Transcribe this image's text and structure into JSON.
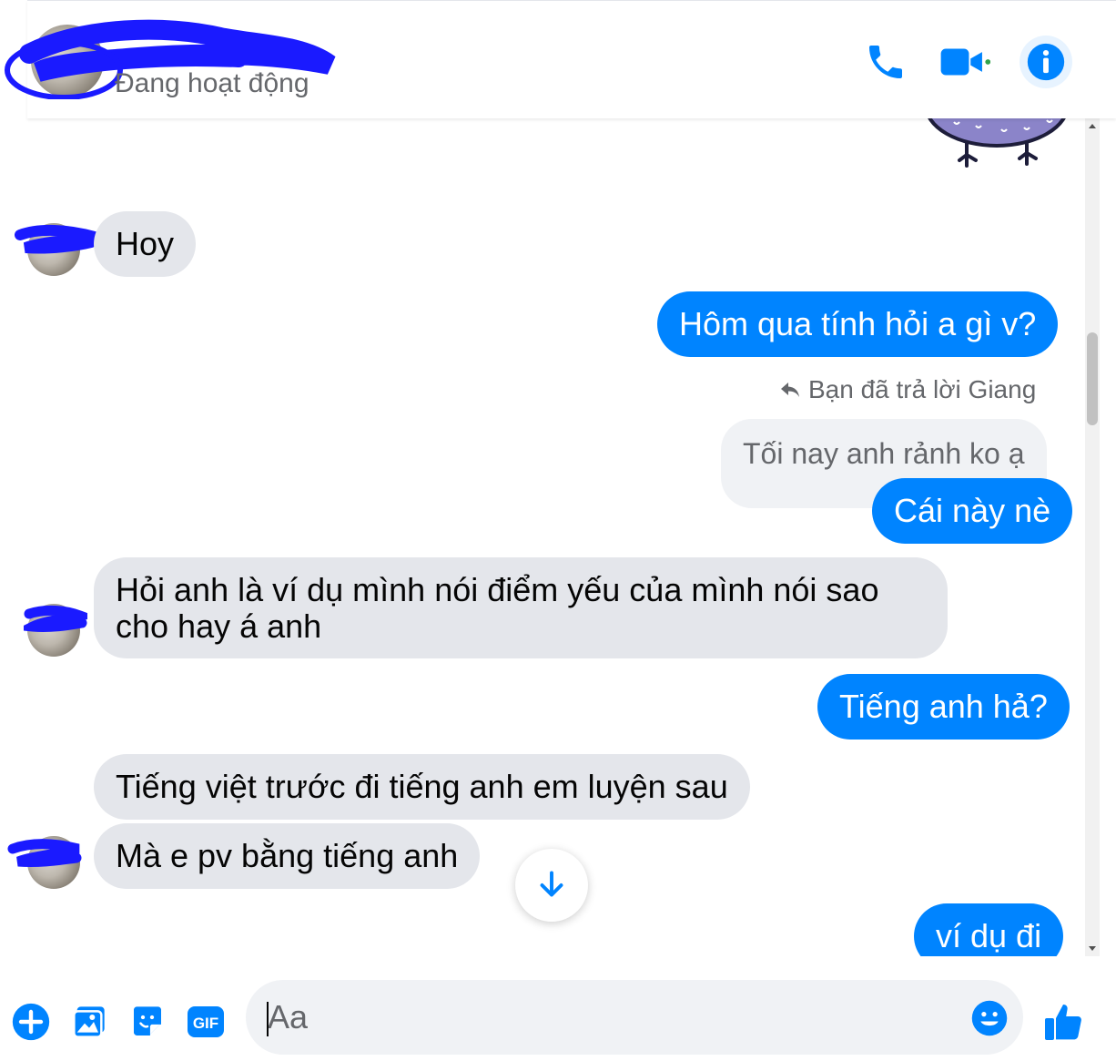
{
  "header": {
    "contact_name": "",
    "status": "Đang hoạt động",
    "accent_color": "#0084ff"
  },
  "messages": [
    {
      "side": "in",
      "text": "Hoy"
    },
    {
      "side": "out",
      "text": "Hôm qua tính hỏi a gì v?"
    },
    {
      "side": "out",
      "reply_label": "Bạn đã trả lời Giang",
      "reply_to": "Tối nay anh rảnh ko ạ",
      "text": "Cái này nè"
    },
    {
      "side": "in",
      "text_line1": "Hỏi anh là ví dụ mình  nói điểm yếu của mình nói sao",
      "text_line2": "cho  hay á anh"
    },
    {
      "side": "out",
      "text": "Tiếng anh hả?"
    },
    {
      "side": "in",
      "text": "Tiếng việt trước đi tiếng anh em luyện  sau"
    },
    {
      "side": "in",
      "text": "Mà e pv bằng tiếng anh"
    },
    {
      "side": "out",
      "text": "ví dụ đi"
    }
  ],
  "composer": {
    "placeholder": "Aa",
    "icons": [
      "plus-circle-icon",
      "photo-icon",
      "sticker-icon",
      "gif-icon",
      "emoji-icon",
      "thumbs-up-icon"
    ],
    "gif_label": "GIF"
  },
  "icons": {
    "call": "phone-icon",
    "video": "video-camera-icon",
    "info": "info-icon",
    "scroll_down": "arrow-down-icon"
  }
}
